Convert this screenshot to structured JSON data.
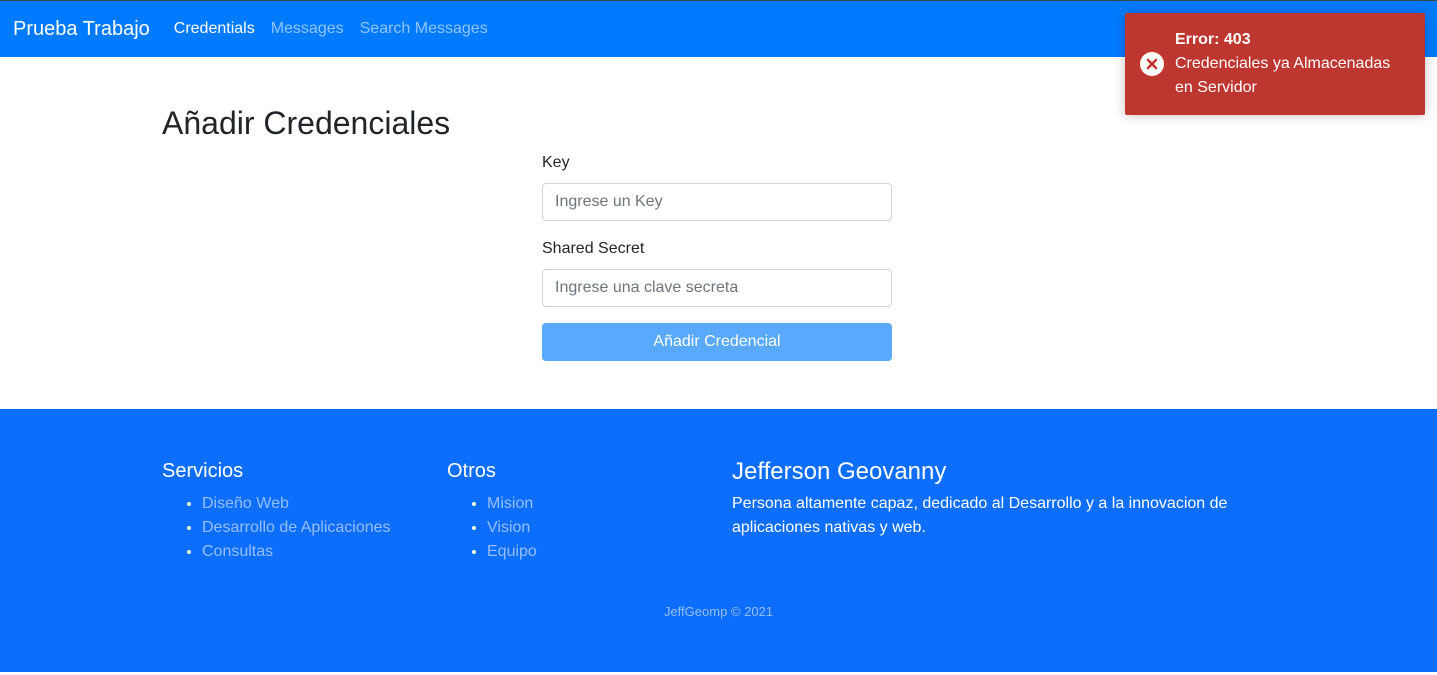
{
  "navbar": {
    "brand": "Prueba Trabajo",
    "links": [
      {
        "label": "Credentials",
        "active": true
      },
      {
        "label": "Messages",
        "active": false
      },
      {
        "label": "Search Messages",
        "active": false
      }
    ],
    "bg_color": "#007bff"
  },
  "main": {
    "title": "Añadir Credenciales",
    "form": {
      "key_label": "Key",
      "key_placeholder": "Ingrese un Key",
      "key_value": "",
      "secret_label": "Shared Secret",
      "secret_placeholder": "Ingrese una clave secreta",
      "secret_value": "",
      "submit_label": "Añadir Credencial"
    }
  },
  "footer": {
    "services": {
      "title": "Servicios",
      "items": [
        "Diseño Web",
        "Desarrollo de Aplicaciones",
        "Consultas"
      ]
    },
    "others": {
      "title": "Otros",
      "items": [
        "Mision",
        "Vision",
        "Equipo"
      ]
    },
    "about": {
      "title": "Jefferson Geovanny",
      "text": "Persona altamente capaz, dedicado al Desarrollo y a la innovacion de aplicaciones nativas y web."
    },
    "copyright": "JeffGeomp © 2021",
    "bg_color": "#0d6efd"
  },
  "toast": {
    "title": "Error: 403",
    "message": "Credenciales ya Almacenadas en Servidor",
    "icon": "error-circle-x-icon",
    "bg_color": "#bd362f"
  }
}
